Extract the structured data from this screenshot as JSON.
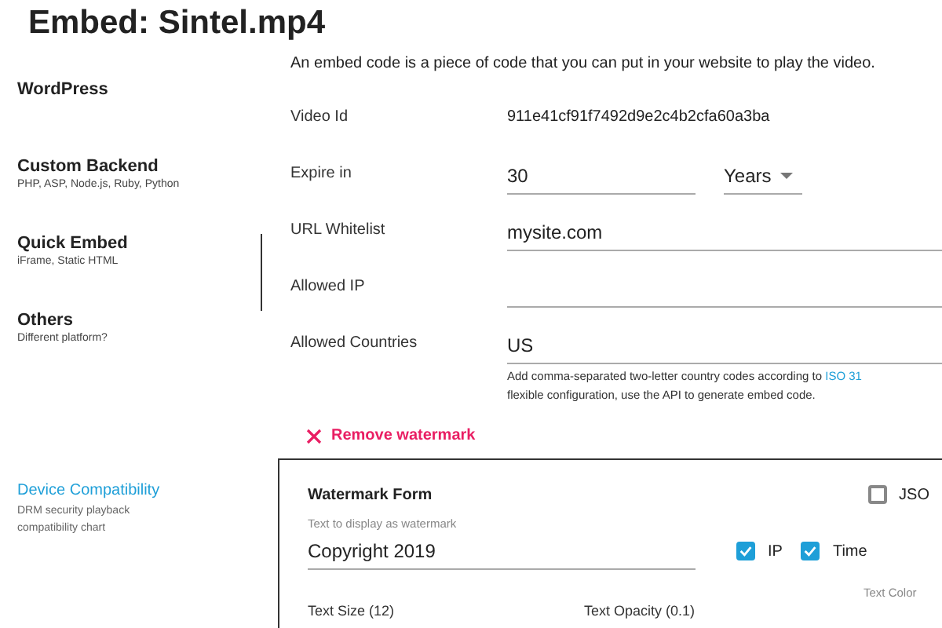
{
  "title": "Embed: Sintel.mp4",
  "sidebar": {
    "items": [
      {
        "label": "WordPress",
        "selected": false
      },
      {
        "label": "Custom Backend",
        "sub": "PHP, ASP, Node.js, Ruby, Python",
        "selected": false
      },
      {
        "label": "Quick Embed",
        "sub": "iFrame, Static HTML",
        "selected": true
      },
      {
        "label": "Others",
        "sub": "Different platform?",
        "selected": false
      }
    ],
    "link": {
      "label": "Device Compatibility",
      "sub": "DRM security playback compatibility chart"
    }
  },
  "intro": "An embed code is a piece of code that you can put in your website to play the video.",
  "fields": [
    {
      "kind": "text",
      "label": "Video Id",
      "value": "911e41cf91f7492d9e2c4b2cfa60a3ba"
    },
    {
      "kind": "expire",
      "label": "Expire in",
      "value": "30",
      "unit": "Years"
    },
    {
      "kind": "input",
      "label": "URL Whitelist",
      "value": "mysite.com"
    },
    {
      "kind": "input",
      "label": "Allowed IP"
    },
    {
      "kind": "input",
      "label": "Allowed Countries",
      "value": "US",
      "help": "Add comma-separated two-letter country codes according to ",
      "help_link": "ISO 31",
      "help2": "flexible configuration, use the API to generate embed code."
    }
  ],
  "remove_watermark": "Remove watermark",
  "watermark": {
    "title": "Watermark Form",
    "json": {
      "label": "JSO",
      "checked": false
    },
    "text_label": "Text to display as watermark",
    "text_value": "Copyright 2019",
    "options": [
      {
        "label": "IP",
        "checked": true
      },
      {
        "label": "Time",
        "checked": true
      }
    ],
    "color_label": "Text Color",
    "size_label": "Text Size (12)",
    "opacity_label": "Text Opacity (0.1)"
  }
}
